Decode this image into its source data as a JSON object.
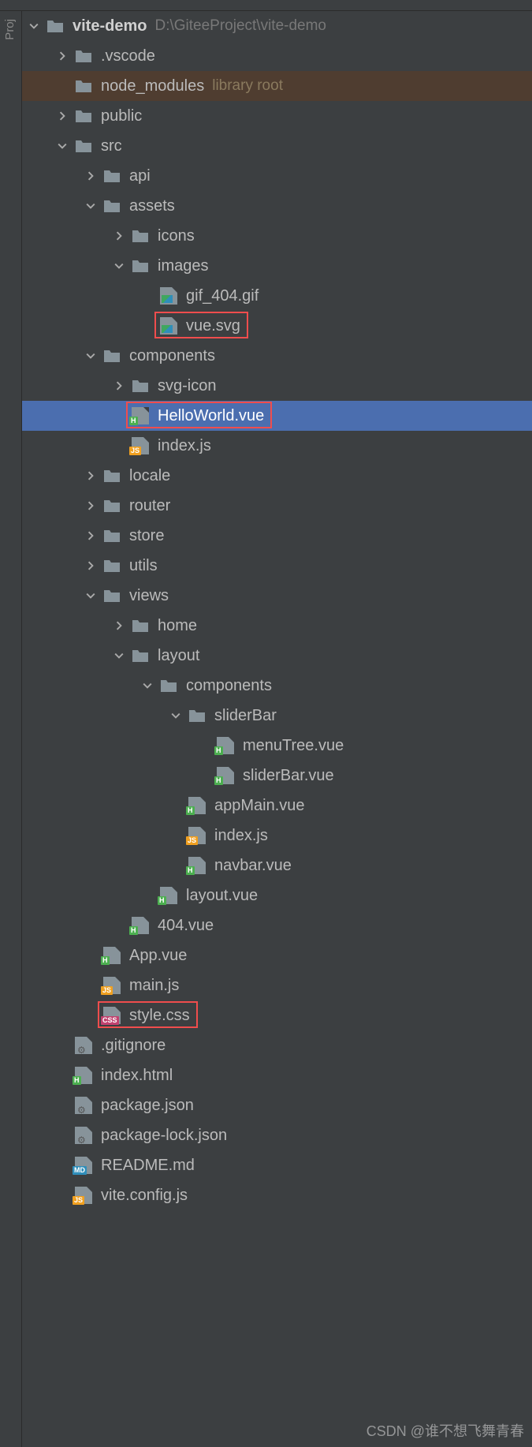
{
  "project": {
    "name": "vite-demo",
    "path": "D:\\GiteeProject\\vite-demo"
  },
  "libraryRootLabel": "library root",
  "watermark": "CSDN @谁不想飞舞青春",
  "tree": [
    {
      "depth": 0,
      "arrow": "down",
      "icon": "folder",
      "label": "vite-demo",
      "bold": true,
      "suffix": "path"
    },
    {
      "depth": 1,
      "arrow": "right",
      "icon": "folder",
      "label": ".vscode"
    },
    {
      "depth": 1,
      "arrow": "none",
      "icon": "folder",
      "label": "node_modules",
      "excluded": true,
      "suffix": "lib"
    },
    {
      "depth": 1,
      "arrow": "right",
      "icon": "folder",
      "label": "public"
    },
    {
      "depth": 1,
      "arrow": "down",
      "icon": "folder",
      "label": "src"
    },
    {
      "depth": 2,
      "arrow": "right",
      "icon": "folder",
      "label": "api"
    },
    {
      "depth": 2,
      "arrow": "down",
      "icon": "folder",
      "label": "assets"
    },
    {
      "depth": 3,
      "arrow": "right",
      "icon": "folder",
      "label": "icons"
    },
    {
      "depth": 3,
      "arrow": "down",
      "icon": "folder",
      "label": "images"
    },
    {
      "depth": 4,
      "arrow": "none",
      "icon": "image",
      "label": "gif_404.gif"
    },
    {
      "depth": 4,
      "arrow": "none",
      "icon": "image",
      "label": "vue.svg",
      "boxed": true
    },
    {
      "depth": 2,
      "arrow": "down",
      "icon": "folder",
      "label": "components"
    },
    {
      "depth": 3,
      "arrow": "right",
      "icon": "folder",
      "label": "svg-icon"
    },
    {
      "depth": 3,
      "arrow": "none",
      "icon": "vue",
      "label": "HelloWorld.vue",
      "selected": true,
      "boxed": true
    },
    {
      "depth": 3,
      "arrow": "none",
      "icon": "js",
      "label": "index.js"
    },
    {
      "depth": 2,
      "arrow": "right",
      "icon": "folder",
      "label": "locale"
    },
    {
      "depth": 2,
      "arrow": "right",
      "icon": "folder",
      "label": "router"
    },
    {
      "depth": 2,
      "arrow": "right",
      "icon": "folder",
      "label": "store"
    },
    {
      "depth": 2,
      "arrow": "right",
      "icon": "folder",
      "label": "utils"
    },
    {
      "depth": 2,
      "arrow": "down",
      "icon": "folder",
      "label": "views"
    },
    {
      "depth": 3,
      "arrow": "right",
      "icon": "folder",
      "label": "home"
    },
    {
      "depth": 3,
      "arrow": "down",
      "icon": "folder",
      "label": "layout"
    },
    {
      "depth": 4,
      "arrow": "down",
      "icon": "folder",
      "label": "components"
    },
    {
      "depth": 5,
      "arrow": "down",
      "icon": "folder",
      "label": "sliderBar"
    },
    {
      "depth": 6,
      "arrow": "none",
      "icon": "vue",
      "label": "menuTree.vue"
    },
    {
      "depth": 6,
      "arrow": "none",
      "icon": "vue",
      "label": "sliderBar.vue"
    },
    {
      "depth": 5,
      "arrow": "none",
      "icon": "vue",
      "label": "appMain.vue"
    },
    {
      "depth": 5,
      "arrow": "none",
      "icon": "js",
      "label": "index.js"
    },
    {
      "depth": 5,
      "arrow": "none",
      "icon": "vue",
      "label": "navbar.vue"
    },
    {
      "depth": 4,
      "arrow": "none",
      "icon": "vue",
      "label": "layout.vue"
    },
    {
      "depth": 3,
      "arrow": "none",
      "icon": "vue",
      "label": "404.vue"
    },
    {
      "depth": 2,
      "arrow": "none",
      "icon": "vue",
      "label": "App.vue"
    },
    {
      "depth": 2,
      "arrow": "none",
      "icon": "js",
      "label": "main.js"
    },
    {
      "depth": 2,
      "arrow": "none",
      "icon": "css",
      "label": "style.css",
      "boxed": true
    },
    {
      "depth": 1,
      "arrow": "none",
      "icon": "cfg",
      "label": ".gitignore"
    },
    {
      "depth": 1,
      "arrow": "none",
      "icon": "vue",
      "label": "index.html"
    },
    {
      "depth": 1,
      "arrow": "none",
      "icon": "cfg",
      "label": "package.json"
    },
    {
      "depth": 1,
      "arrow": "none",
      "icon": "cfg",
      "label": "package-lock.json"
    },
    {
      "depth": 1,
      "arrow": "none",
      "icon": "md",
      "label": "README.md"
    },
    {
      "depth": 1,
      "arrow": "none",
      "icon": "js",
      "label": "vite.config.js"
    }
  ]
}
